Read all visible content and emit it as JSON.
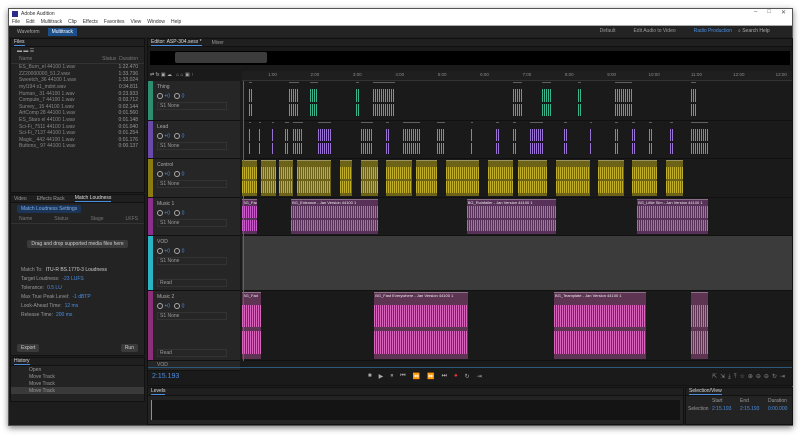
{
  "window": {
    "title": "Adobe Audition",
    "controls": [
      "–",
      "□",
      "✕"
    ]
  },
  "menu": [
    "File",
    "Edit",
    "Multitrack",
    "Clip",
    "Effects",
    "Favorites",
    "View",
    "Window",
    "Help"
  ],
  "toolbar": {
    "modes": [
      "Waveform",
      "Multitrack"
    ],
    "active_mode": "Multitrack",
    "workspaces": [
      "Default",
      "Edit Audio to Video",
      "Radio Production"
    ],
    "active_workspace": "Radio Production",
    "search_placeholder": "Search Help"
  },
  "files": {
    "tab": "Files",
    "columns": [
      "Name",
      "Status",
      "Duration"
    ],
    "items": [
      {
        "name": "ES_Burn_el 44100 1.wav",
        "duration": "1:22.470"
      },
      {
        "name": "ZZ20000000_51.2.wav",
        "duration": "1:33.736"
      },
      {
        "name": "Sweetch_36 44100 1.wav",
        "duration": "1:33.024"
      },
      {
        "name": "myl194 s1_mdnt.wav",
        "duration": "0:34.811"
      },
      {
        "name": "Human_ 31 44100 1.wav",
        "duration": "0:23.933"
      },
      {
        "name": "Compute_7 44100 1.wav",
        "duration": "0:03.712"
      },
      {
        "name": "Survey_ 15 44100 1.wav",
        "duration": "0:02.144"
      },
      {
        "name": "ArtComp 28 44100 1.wav",
        "duration": "0:01.560"
      },
      {
        "name": "ES_Stars el 44100 1.wav",
        "duration": "0:01.148"
      },
      {
        "name": "Sci-Fi_7511 44100 1.wav",
        "duration": "0:01.040"
      },
      {
        "name": "Sci-Fi_7137 44100 1.wav",
        "duration": "0:01.254"
      },
      {
        "name": "Magic_ 442 44100 1.wav",
        "duration": "0:01.176"
      },
      {
        "name": "Buttons_ 97 44100 1.wav",
        "duration": "0:00.137"
      }
    ]
  },
  "loudness": {
    "tabs": [
      "Video",
      "Effects Rack",
      "Match Loudness"
    ],
    "active": "Match Loudness",
    "settings_button": "Match Loudness Settings",
    "columns": [
      "Name",
      "Status",
      "Stage",
      "LKFS"
    ],
    "drop_hint": "Drag and drop supported media files here",
    "match_to_label": "Match To:",
    "match_to": "ITU-R BS.1770-3 Loudness",
    "fields": [
      {
        "label": "Target Loudness:",
        "value": "-23 LUFS"
      },
      {
        "label": "Tolerance:",
        "value": "0.5 LU"
      },
      {
        "label": "Max True Peak Level:",
        "value": "-1 dBTP"
      },
      {
        "label": "Look-Ahead Time:",
        "value": "12 ms"
      },
      {
        "label": "Release Time:",
        "value": "200 ms"
      }
    ],
    "buttons": [
      "Export",
      "Run"
    ]
  },
  "history": {
    "tab": "History",
    "items": [
      "Open",
      "Move Track",
      "Move Track",
      "Move Track"
    ],
    "selected": 3
  },
  "editor": {
    "tab": "Editor: ASP-304.sesx *",
    "tab2": "Mixer",
    "timecode": "2:15.193",
    "ruler_min": [
      0.28,
      13.3
    ],
    "ticks": [
      "1:00",
      "2:00",
      "3:00",
      "4:00",
      "5:00",
      "6:00",
      "7:00",
      "8:00",
      "9:00",
      "10:00",
      "11:00",
      "12:00",
      "13:00"
    ],
    "tracks": [
      {
        "name": "Thing",
        "color": "#3fc49a",
        "stripe": "#2e8f70",
        "input": "S1 None",
        "clips": [
          [
            0.44,
            0.52
          ],
          [
            1.4,
            1.62
          ],
          [
            1.88,
            2.08
          ],
          [
            2.96,
            3.04
          ],
          [
            3.38,
            3.88
          ],
          [
            6.68,
            6.88
          ],
          [
            7.36,
            7.56
          ],
          [
            8.2,
            8.28
          ],
          [
            9.08,
            9.48
          ],
          [
            10.88,
            10.98
          ]
        ]
      },
      {
        "name": "Lead",
        "color": "#a77de8",
        "stripe": "#6a4aa8",
        "input": "S1 None",
        "clips": [
          [
            0.44,
            0.5
          ],
          [
            0.68,
            0.74
          ],
          [
            0.98,
            1.04
          ],
          [
            1.3,
            1.4
          ],
          [
            1.48,
            1.72
          ],
          [
            2.08,
            2.38
          ],
          [
            3.08,
            3.38
          ],
          [
            3.68,
            3.74
          ],
          [
            4.08,
            4.48
          ],
          [
            4.88,
            5.08
          ],
          [
            5.68,
            5.74
          ],
          [
            6.28,
            6.34
          ],
          [
            6.68,
            6.74
          ],
          [
            7.08,
            7.38
          ],
          [
            7.88,
            7.94
          ],
          [
            8.48,
            8.54
          ],
          [
            9.08,
            9.14
          ],
          [
            9.48,
            9.54
          ],
          [
            9.88,
            9.94
          ],
          [
            10.38,
            10.44
          ],
          [
            10.88,
            11.28
          ]
        ]
      },
      {
        "name": "Control",
        "color": "#c9b62a",
        "stripe": "#8a7c10",
        "input": "S1 None",
        "clips": [
          [
            0.28,
            0.64
          ],
          [
            0.72,
            1.08
          ],
          [
            1.16,
            1.48
          ],
          [
            1.58,
            2.38
          ],
          [
            2.58,
            2.88
          ],
          [
            3.08,
            3.48
          ],
          [
            3.68,
            4.28
          ],
          [
            4.38,
            4.88
          ],
          [
            5.08,
            5.88
          ],
          [
            6.08,
            6.68
          ],
          [
            6.78,
            7.48
          ],
          [
            7.68,
            8.48
          ],
          [
            8.68,
            9.28
          ],
          [
            9.48,
            10.08
          ],
          [
            10.28,
            10.68
          ]
        ]
      },
      {
        "name": "Music 1",
        "color": "#d65fd6",
        "stripe": "#8c2f8c",
        "input": "S1 None",
        "clips": [
          [
            0.28,
            0.64,
            "BG_Fade"
          ],
          [
            1.44,
            3.48,
            "BG_Entrance - Jan Version 44100 1"
          ],
          [
            5.58,
            7.68,
            "BG_Ruinfaller - Jan Version 44100 1"
          ],
          [
            9.6,
            11.28,
            "BG_Little Sim - Jan Version 44100 1"
          ]
        ]
      },
      {
        "name": "VOD",
        "color": "#777",
        "stripe": "#2bb5c4",
        "input": "S1 None",
        "clips": [],
        "mode": "Read"
      },
      {
        "name": "Music 2",
        "color": "#e66ac7",
        "stripe": "#8c2f78",
        "input": "S1 None",
        "clips": [
          [
            0.28,
            0.72,
            "BG_Fad"
          ],
          [
            3.4,
            5.62,
            "BG_Fast Everywhere - Jan Version 44100 1"
          ],
          [
            7.64,
            9.8,
            "BG_Teamplate - Jan Version 44100 1"
          ],
          [
            10.88,
            11.28,
            ""
          ]
        ],
        "mode": "Read"
      }
    ],
    "bus": "VOD"
  },
  "transport": [
    "■",
    "▶",
    "⏸",
    "⏮",
    "⏪",
    "⏩",
    "⏭",
    "●",
    "↻",
    "⇥"
  ],
  "levels": {
    "tab": "Levels"
  },
  "selection": {
    "tab": "Selection/View",
    "columns": [
      "Start",
      "End",
      "Duration"
    ],
    "row_label": "Selection",
    "start": "2:15.193",
    "end": "2:15.193",
    "duration": "0:00.000"
  }
}
